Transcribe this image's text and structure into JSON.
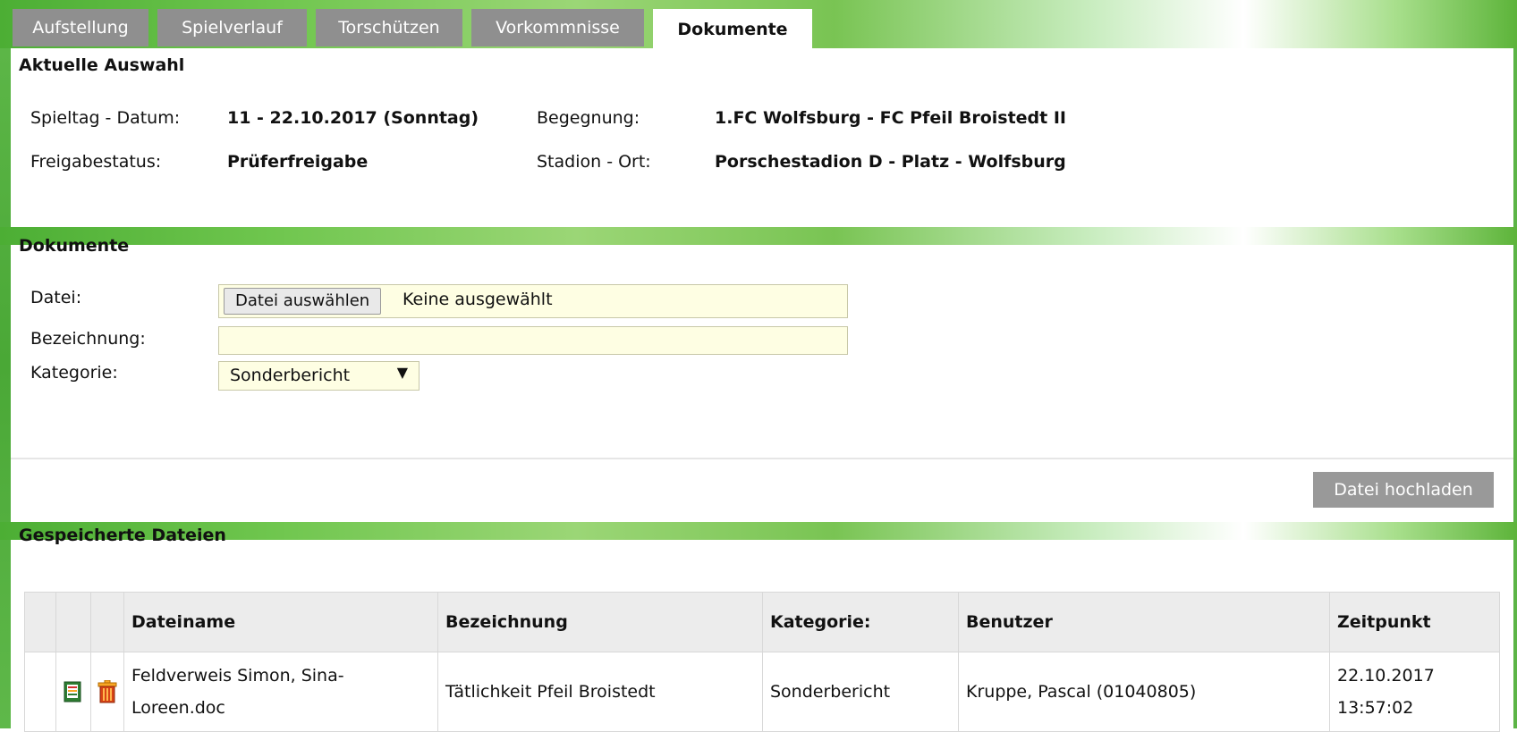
{
  "tabs": [
    {
      "label": "Aufstellung",
      "active": false
    },
    {
      "label": "Spielverlauf",
      "active": false
    },
    {
      "label": "Torschützen",
      "active": false
    },
    {
      "label": "Vorkommnisse",
      "active": false
    },
    {
      "label": "Dokumente",
      "active": true
    }
  ],
  "selection": {
    "title": "Aktuelle Auswahl",
    "matchday_label": "Spieltag - Datum:",
    "matchday_value": "11 - 22.10.2017 (Sonntag)",
    "fixture_label": "Begegnung:",
    "fixture_value": "1.FC Wolfsburg - FC Pfeil Broistedt II",
    "status_label": "Freigabestatus:",
    "status_value": "Prüferfreigabe",
    "venue_label": "Stadion - Ort:",
    "venue_value": "Porschestadion D - Platz - Wolfsburg"
  },
  "documents": {
    "title": "Dokumente",
    "file_label": "Datei:",
    "file_button": "Datei auswählen",
    "file_status": "Keine ausgewählt",
    "name_label": "Bezeichnung:",
    "name_value": "",
    "category_label": "Kategorie:",
    "category_selected": "Sonderbericht",
    "upload_button": "Datei hochladen"
  },
  "saved": {
    "title": "Gespeicherte Dateien",
    "columns": [
      "Dateiname",
      "Bezeichnung",
      "Kategorie:",
      "Benutzer",
      "Zeitpunkt"
    ],
    "rows": [
      {
        "filename_line1": "Feldverweis Simon, Sina-",
        "filename_line2": "Loreen.doc",
        "description": "Tätlichkeit Pfeil Broistedt",
        "category": "Sonderbericht",
        "user": "Kruppe, Pascal (01040805)",
        "date": "22.10.2017",
        "time": "13:57:02",
        "icons": [
          "document-view-icon",
          "trash-icon"
        ]
      }
    ]
  },
  "colors": {
    "tab_inactive": "#8f8f8f",
    "accent_green": "#5cb446",
    "input_yellow": "#fefee3",
    "button_gray": "#999999"
  }
}
